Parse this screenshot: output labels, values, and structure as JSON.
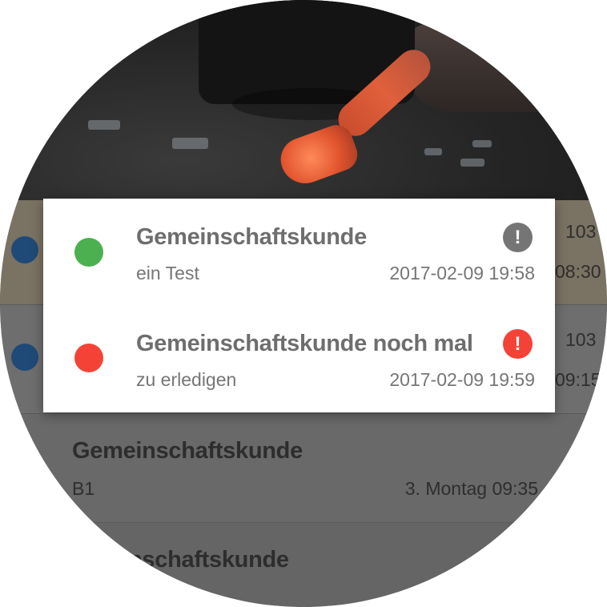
{
  "dialog": {
    "items": [
      {
        "title": "Gemeinschaftskunde",
        "subtitle": "ein Test",
        "timestamp": "2017-02-09 19:58",
        "status_color": "#4caf50",
        "priority_color": "#757575",
        "priority_icon": "exclamation-icon"
      },
      {
        "title": "Gemeinschaftskunde noch mal",
        "subtitle": "zu erledigen",
        "timestamp": "2017-02-09 19:59",
        "status_color": "#f44336",
        "priority_color": "#f44336",
        "priority_icon": "exclamation-icon"
      }
    ]
  },
  "list": {
    "rows": [
      {
        "room": "103",
        "time": "08:30"
      },
      {
        "room": "103",
        "time": "09:15"
      },
      {
        "title": "Gemeinschaftskunde",
        "subtitle": "B1",
        "time": "3. Montag 09:35"
      },
      {
        "title": "nschaftskunde"
      }
    ]
  },
  "colors": {
    "row_dot": "#1f4a77",
    "dialog_bg": "#ffffff"
  }
}
